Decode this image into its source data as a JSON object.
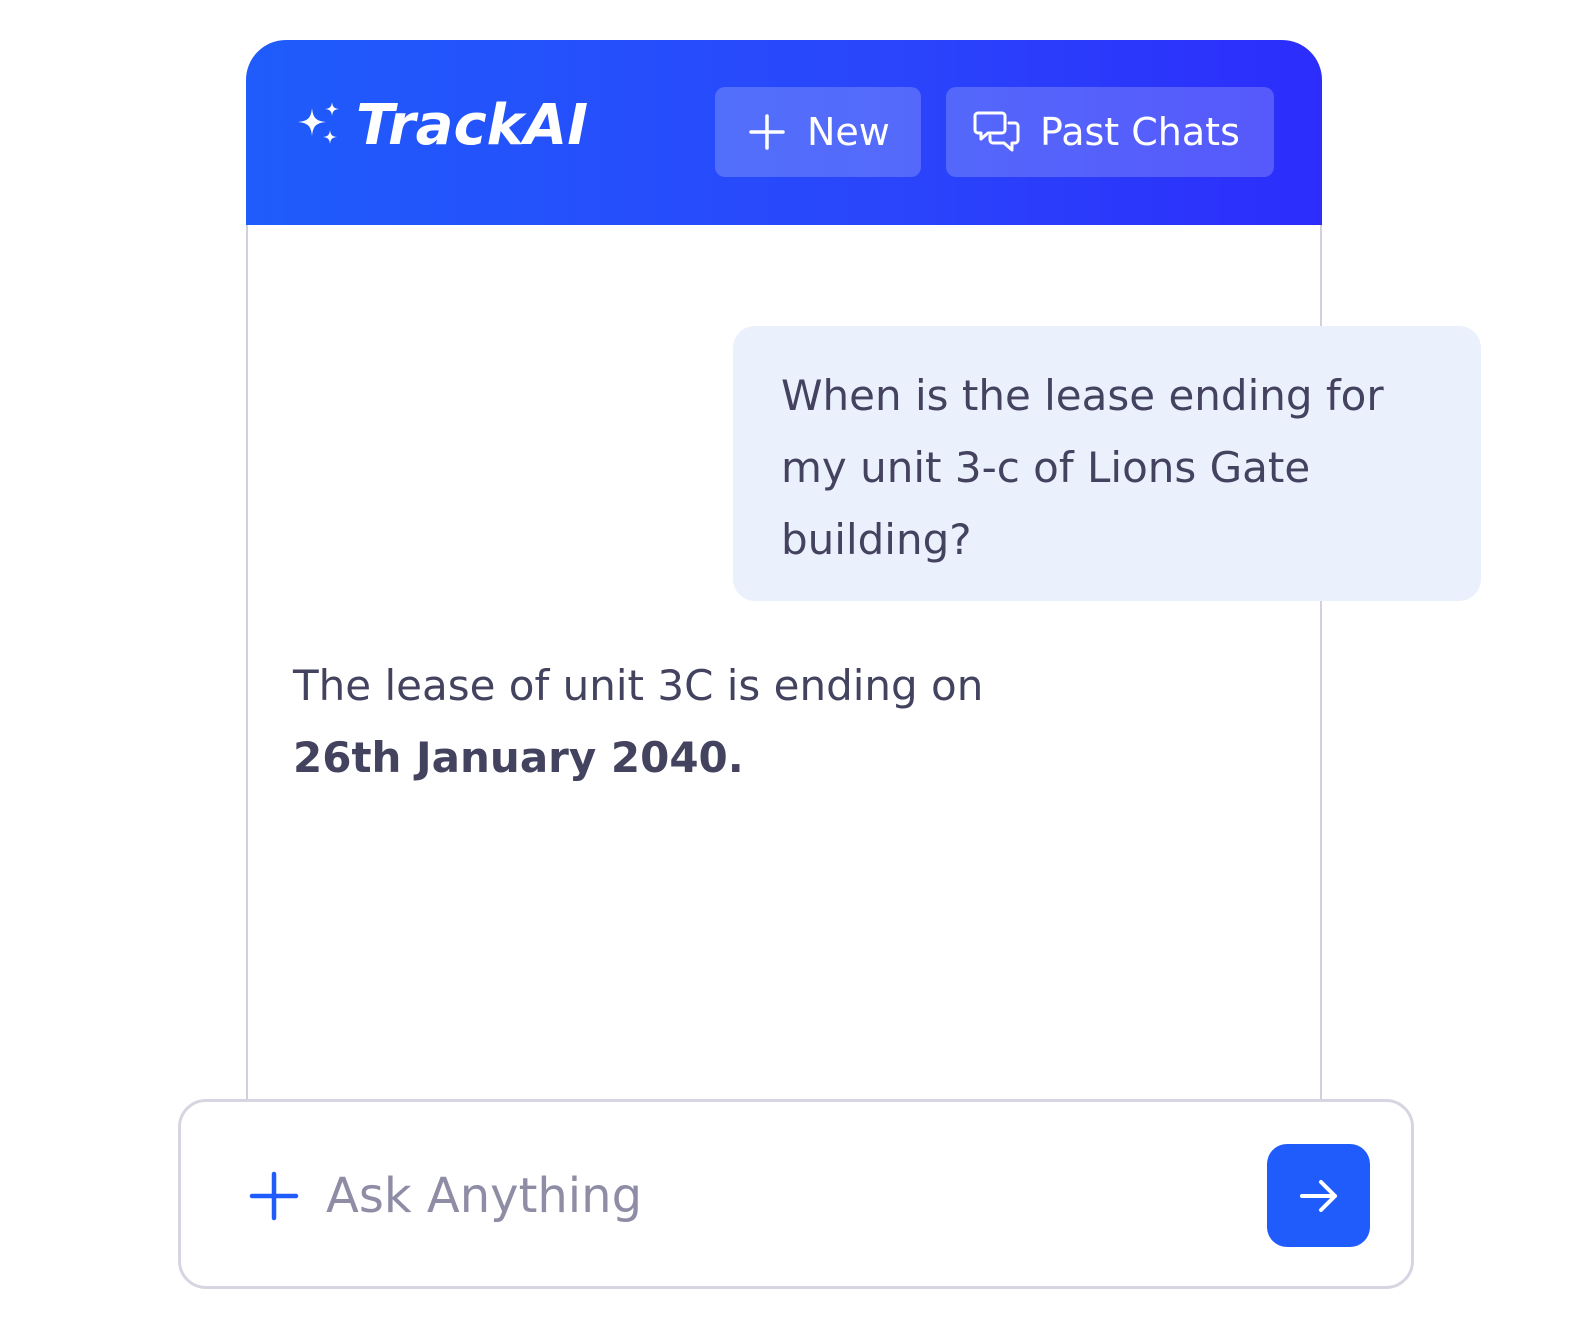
{
  "header": {
    "brand_name": "TrackAI",
    "new_label": "New",
    "past_chats_label": "Past Chats",
    "gradient_start": "#1f5cfb",
    "gradient_end": "#2c2dfb"
  },
  "messages": [
    {
      "role": "user",
      "text": "When is the lease ending for my unit 3-c of Lions Gate building?"
    },
    {
      "role": "assistant",
      "text": "The lease of unit 3C is ending on",
      "emphasis": "26th January 2040."
    }
  ],
  "composer": {
    "placeholder": "Ask Anything",
    "value": "",
    "attach_icon": "plus-icon",
    "send_icon": "arrow-right-icon",
    "accent_color": "#1f5cfb"
  },
  "colors": {
    "user_bubble_bg": "#ebf0fd",
    "text": "#43425f",
    "placeholder": "#8f8da5",
    "border": "#d3d0dc"
  }
}
